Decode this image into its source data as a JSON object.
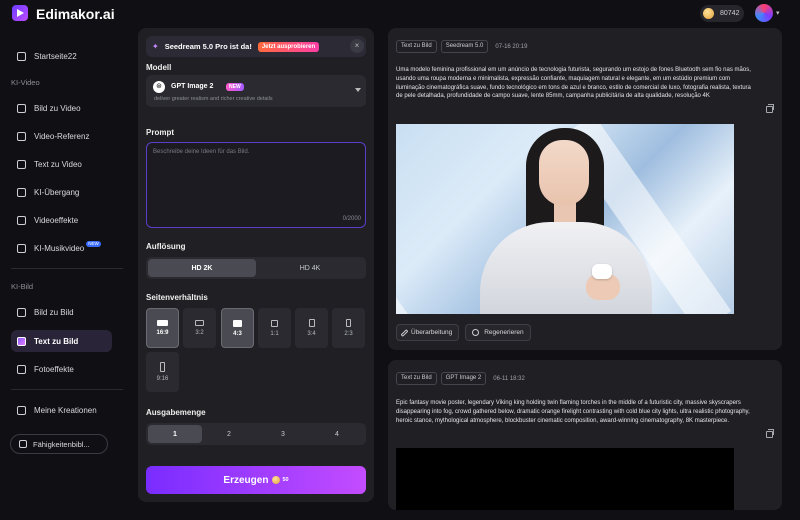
{
  "app": {
    "name": "Edimakor.ai",
    "credits": "80742"
  },
  "sidebar": {
    "home": "Startseite22",
    "sections": [
      {
        "label": "KI-Video",
        "items": [
          "Bild zu Video",
          "Video-Referenz",
          "Text zu Video",
          "KI-Übergang",
          "Videoeffekte",
          "KI-Musikvideo"
        ]
      },
      {
        "label": "KI-Bild",
        "items": [
          "Bild zu Bild",
          "Text zu Bild",
          "Fotoeffekte"
        ]
      }
    ],
    "music_video_badge": "NEW",
    "active_item": "Text zu Bild",
    "my_creations": "Meine Kreationen",
    "skills_button": "Fähigkeitenbibl..."
  },
  "promo": {
    "text": "Seedream 5.0 Pro ist da!",
    "cta": "Jetzt ausprobieren",
    "close": "×"
  },
  "form": {
    "model_label": "Modell",
    "model": {
      "name": "GPT Image 2",
      "badge": "NEW",
      "description": "deliver greater realism and richer creative details"
    },
    "prompt_label": "Prompt",
    "prompt_placeholder": "Beschreibe deine Ideen für das Bild.",
    "prompt_count": "0/2000",
    "resolution_label": "Auflösung",
    "resolution_options": [
      "HD 2K",
      "HD 4K"
    ],
    "resolution_selected": "HD 2K",
    "aspect_label": "Seitenverhältnis",
    "aspect_options": [
      "16:9",
      "3:2",
      "4:3",
      "1:1",
      "3:4",
      "2:3",
      "9:16"
    ],
    "aspect_selected": [
      "16:9",
      "4:3"
    ],
    "quantity_label": "Ausgabemenge",
    "quantity_options": [
      "1",
      "2",
      "3",
      "4"
    ],
    "quantity_selected": "1",
    "generate_label": "Erzeugen",
    "generate_cost": "50"
  },
  "results": [
    {
      "tags": [
        "Text zu Bild",
        "Seedream 5.0"
      ],
      "time": "07-16 20:19",
      "prompt": "Uma modelo feminina profissional em um anúncio de tecnologia futurista, segurando um estojo de fones Bluetooth sem fio nas mãos, usando uma roupa moderna e minimalista, expressão confiante, maquiagem natural e elegante, em um estúdio premium com iluminação cinematográfica suave, fundo tecnológico em tons de azul e branco, estilo de comercial de luxo, fotografia realista, textura de pele detalhada, profundidade de campo suave, lente 85mm, campanha publicitária de alta qualidade, resolução 4K",
      "actions": [
        "Überarbeitung",
        "Regenerieren"
      ]
    },
    {
      "tags": [
        "Text zu Bild",
        "GPT Image 2"
      ],
      "time": "06-11 18:32",
      "prompt": "Epic fantasy movie poster, legendary Viking king holding twin flaming torches in the middle of a futuristic city, massive skyscrapers disappearing into fog, crowd gathered below, dramatic orange firelight contrasting with cold blue city lights, ultra realistic photography, heroic stance, mythological atmosphere, blockbuster cinematic composition, award-winning cinematography, 8K masterpiece."
    }
  ]
}
